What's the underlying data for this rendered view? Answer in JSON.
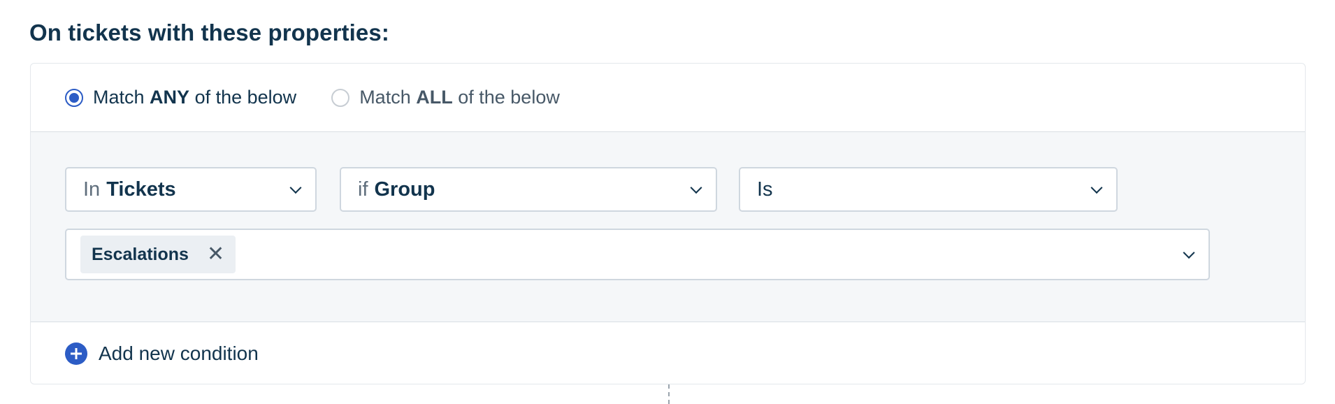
{
  "page": {
    "title": "On tickets with these properties:"
  },
  "match": {
    "any": {
      "prefix": "Match",
      "keyword": "ANY",
      "suffix": "of the below",
      "checked": true
    },
    "all": {
      "prefix": "Match",
      "keyword": "ALL",
      "suffix": "of the below",
      "checked": false
    }
  },
  "condition": {
    "scope": {
      "prefix": "In",
      "value": "Tickets"
    },
    "field": {
      "prefix": "if",
      "value": "Group"
    },
    "operator": {
      "value": "Is"
    },
    "values": [
      {
        "label": "Escalations",
        "remove": "✕"
      }
    ]
  },
  "actions": {
    "add_condition": "Add new condition"
  },
  "colors": {
    "accent": "#2c5cc5",
    "text": "#12344d",
    "panel_bg": "#f5f7f9"
  }
}
